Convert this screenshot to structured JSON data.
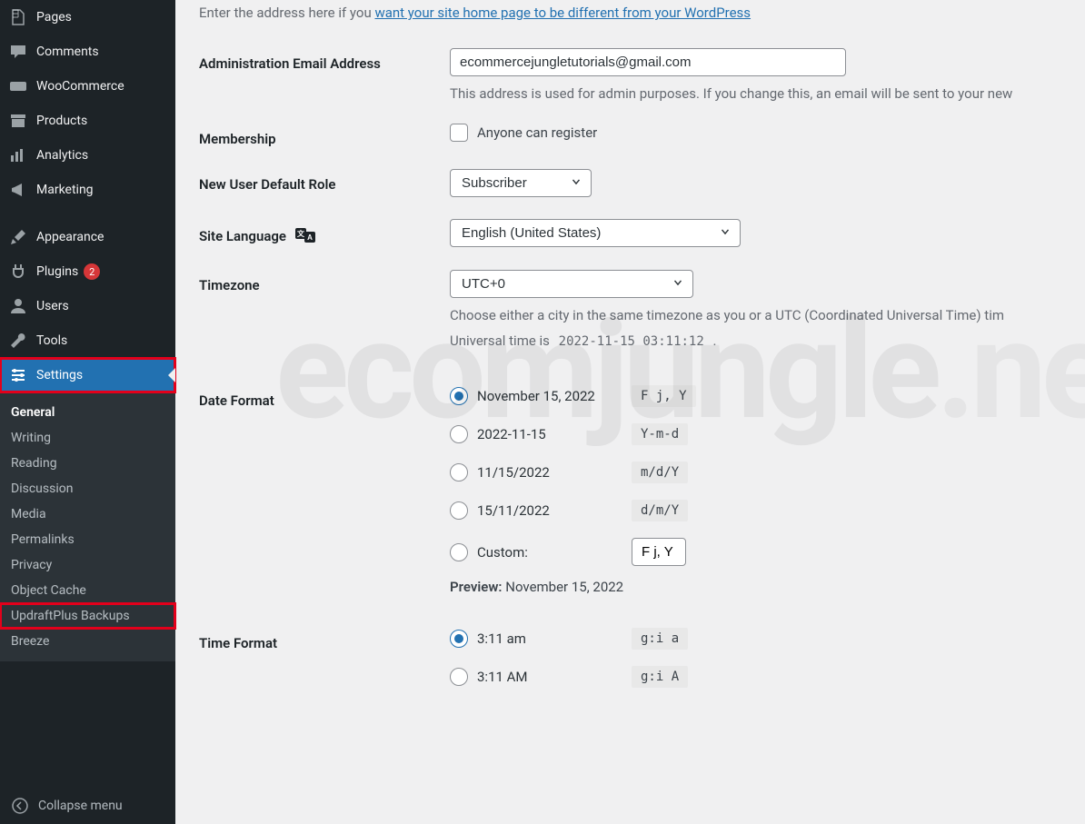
{
  "sidebar": {
    "items": [
      {
        "id": "pages",
        "label": "Pages",
        "icon": "pages"
      },
      {
        "id": "comments",
        "label": "Comments",
        "icon": "comment"
      },
      {
        "id": "woocommerce",
        "label": "WooCommerce",
        "icon": "woo"
      },
      {
        "id": "products",
        "label": "Products",
        "icon": "archive"
      },
      {
        "id": "analytics",
        "label": "Analytics",
        "icon": "chart"
      },
      {
        "id": "marketing",
        "label": "Marketing",
        "icon": "megaphone"
      }
    ],
    "items2": [
      {
        "id": "appearance",
        "label": "Appearance",
        "icon": "brush"
      },
      {
        "id": "plugins",
        "label": "Plugins",
        "icon": "plug",
        "badge": "2"
      },
      {
        "id": "users",
        "label": "Users",
        "icon": "user"
      },
      {
        "id": "tools",
        "label": "Tools",
        "icon": "wrench"
      },
      {
        "id": "settings",
        "label": "Settings",
        "icon": "sliders",
        "active": true
      }
    ],
    "submenu": [
      {
        "label": "General",
        "current": true
      },
      {
        "label": "Writing"
      },
      {
        "label": "Reading"
      },
      {
        "label": "Discussion"
      },
      {
        "label": "Media"
      },
      {
        "label": "Permalinks"
      },
      {
        "label": "Privacy"
      },
      {
        "label": "Object Cache"
      },
      {
        "label": "UpdraftPlus Backups",
        "highlight": true
      },
      {
        "label": "Breeze"
      }
    ],
    "collapse_label": "Collapse menu"
  },
  "intro": {
    "prefix": "Enter the address here if you ",
    "link": "want your site home page to be different from your WordPress"
  },
  "admin_email": {
    "label": "Administration Email Address",
    "value": "ecommercejungletutorials@gmail.com",
    "desc": "This address is used for admin purposes. If you change this, an email will be sent to your new"
  },
  "membership": {
    "label": "Membership",
    "checkbox_label": "Anyone can register"
  },
  "default_role": {
    "label": "New User Default Role",
    "value": "Subscriber"
  },
  "site_language": {
    "label": "Site Language",
    "value": "English (United States)"
  },
  "timezone": {
    "label": "Timezone",
    "value": "UTC+0",
    "desc": "Choose either a city in the same timezone as you or a UTC (Coordinated Universal Time) tim",
    "universal_prefix": "Universal time is ",
    "universal_value": "2022-11-15 03:11:12",
    "universal_suffix": " ."
  },
  "date_format": {
    "label": "Date Format",
    "options": [
      {
        "display": "November 15, 2022",
        "code": "F j, Y",
        "checked": true
      },
      {
        "display": "2022-11-15",
        "code": "Y-m-d"
      },
      {
        "display": "11/15/2022",
        "code": "m/d/Y"
      },
      {
        "display": "15/11/2022",
        "code": "d/m/Y"
      }
    ],
    "custom_label": "Custom:",
    "custom_value": "F j, Y",
    "preview_label": "Preview:",
    "preview_value": "November 15, 2022"
  },
  "time_format": {
    "label": "Time Format",
    "options": [
      {
        "display": "3:11 am",
        "code": "g:i a",
        "checked": true
      },
      {
        "display": "3:11 AM",
        "code": "g:i A"
      }
    ]
  },
  "watermark": {
    "part1": "ecomjungle",
    "part2": ".net"
  }
}
